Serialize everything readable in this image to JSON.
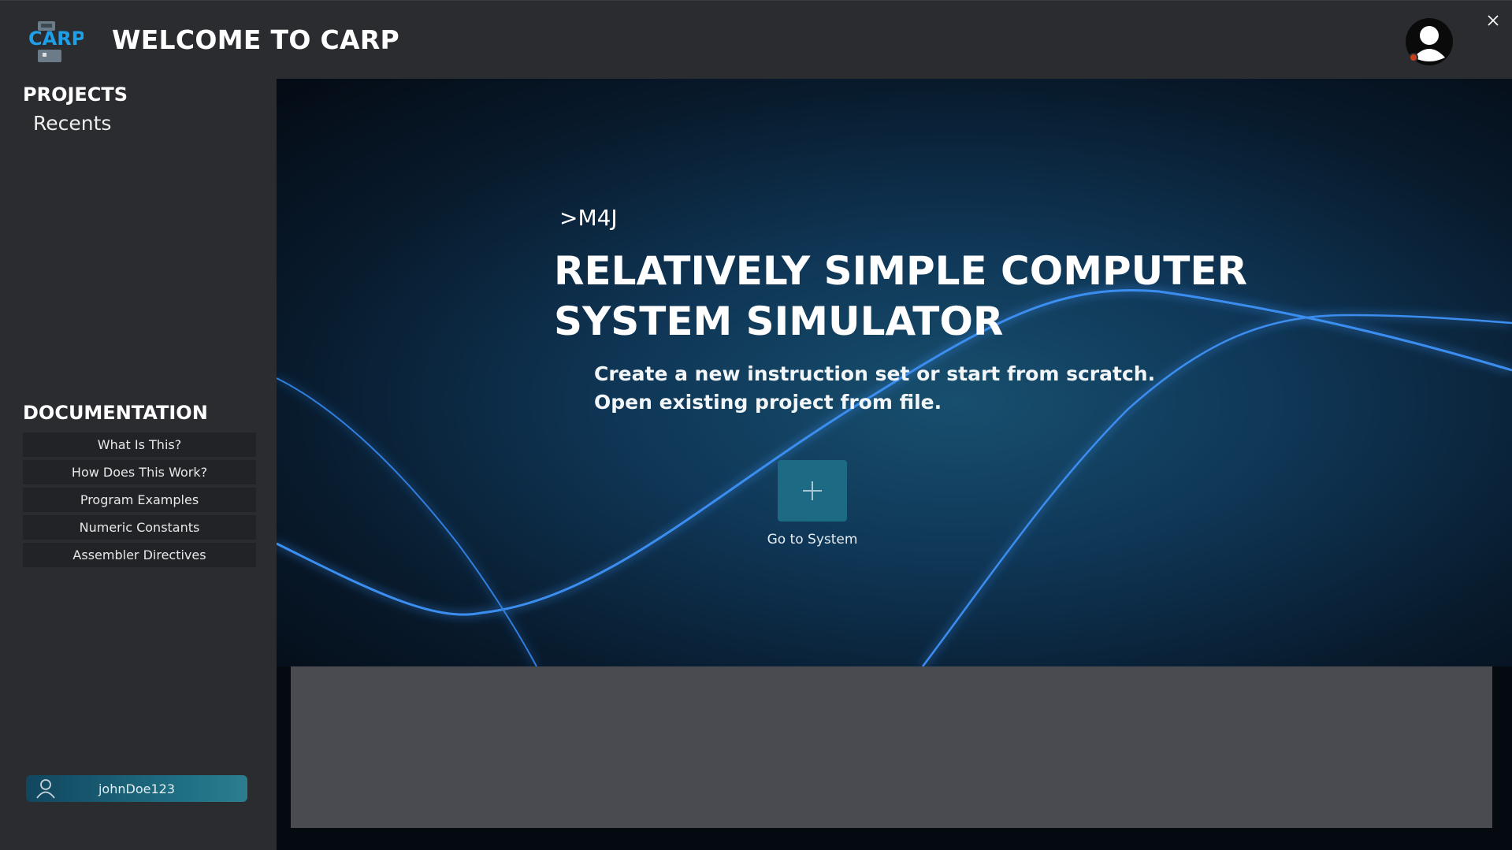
{
  "header": {
    "logo_text": "CARP",
    "title": "WELCOME TO CARP"
  },
  "sidebar": {
    "projects_heading": "PROJECTS",
    "recents_label": "Recents",
    "documentation_heading": "DOCUMENTATION",
    "doc_items": [
      "What Is This?",
      "How Does This Work?",
      "Program Examples",
      "Numeric Constants",
      "Assembler Directives"
    ],
    "username": "johnDoe123"
  },
  "hero": {
    "tag": ">M4J",
    "headline_line1": "RELATIVELY SIMPLE COMPUTER",
    "headline_line2": "SYSTEM SIMULATOR",
    "sub_line1": "Create a new instruction set or start from scratch.",
    "sub_line2": "Open existing project from file.",
    "button_label": "Go to System"
  },
  "colors": {
    "background": "#2b2c30",
    "accent": "#1c6a84",
    "logo_blue": "#1ea0e8",
    "panel": "#4a4b51"
  },
  "icons": {
    "logo": "carp-logo",
    "profile": "user-avatar-icon",
    "close": "close-icon",
    "add": "plus-icon",
    "user": "user-icon"
  }
}
